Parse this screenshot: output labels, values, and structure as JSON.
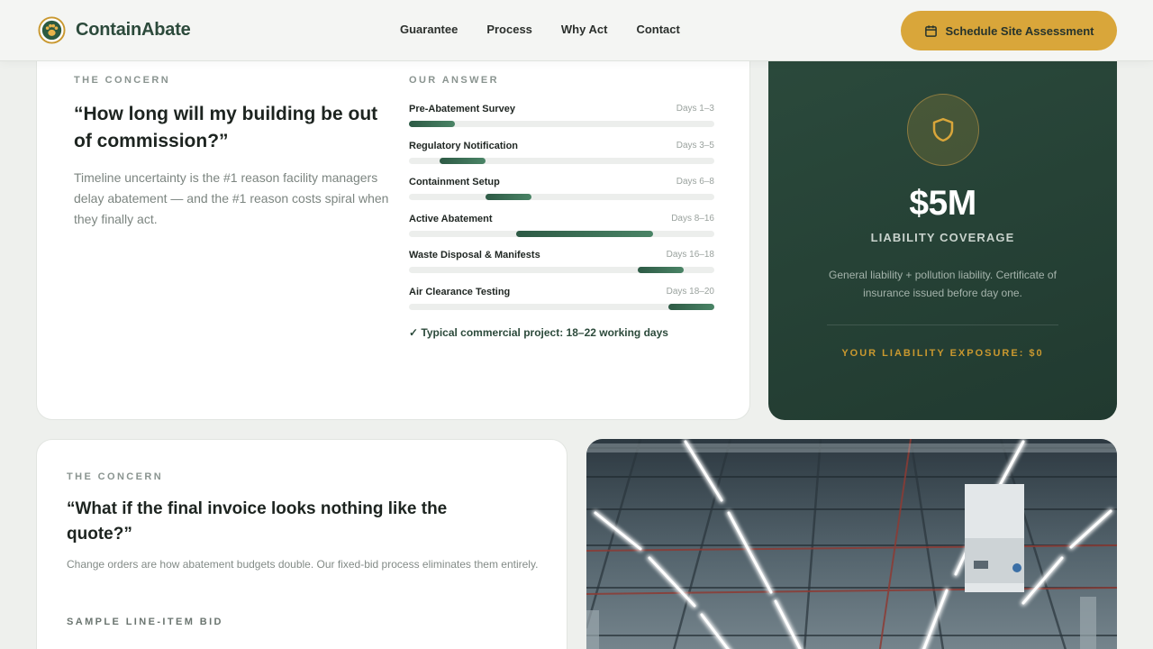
{
  "brand": {
    "name": "ContainAbate",
    "logo_icon": "paw-shield-icon"
  },
  "nav": {
    "items": [
      "Guarantee",
      "Process",
      "Why Act",
      "Contact"
    ]
  },
  "cta": {
    "label": "Schedule Site Assessment",
    "icon": "calendar-icon"
  },
  "concern1": {
    "eyebrow": "THE CONCERN",
    "quote": "“How long will my building be out of commission?”",
    "description": "Timeline uncertainty is the #1 reason facility managers delay abatement — and the #1 reason costs spiral when they finally act.",
    "answer_eyebrow": "OUR ANSWER",
    "timeline": [
      {
        "label": "Pre-Abatement Survey",
        "days": "Days 1–3",
        "start": 1,
        "end": 3
      },
      {
        "label": "Regulatory Notification",
        "days": "Days 3–5",
        "start": 3,
        "end": 5
      },
      {
        "label": "Containment Setup",
        "days": "Days 6–8",
        "start": 6,
        "end": 8
      },
      {
        "label": "Active Abatement",
        "days": "Days 8–16",
        "start": 8,
        "end": 16
      },
      {
        "label": "Waste Disposal & Manifests",
        "days": "Days 16–18",
        "start": 16,
        "end": 18
      },
      {
        "label": "Air Clearance Testing",
        "days": "Days 18–20",
        "start": 18,
        "end": 20
      }
    ],
    "summary": "✓ Typical commercial project: 18–22 working days"
  },
  "guarantee": {
    "icon": "shield-icon",
    "amount": "$5M",
    "title": "LIABILITY COVERAGE",
    "description": "General liability + pollution liability. Certificate of insurance issued before day one.",
    "exposure": "YOUR LIABILITY EXPOSURE: $0",
    "accent": "#d9a63a",
    "background": "#24402f"
  },
  "concern2": {
    "eyebrow": "THE CONCERN",
    "quote": "“What if the final invoice looks nothing like the quote?”",
    "description": "Change orders are how abatement budgets double. Our fixed-bid process eliminates them entirely.",
    "sub_eyebrow": "SAMPLE LINE-ITEM BID"
  },
  "photo": {
    "subject": "warehouse-ceiling-lights-photo"
  },
  "colors": {
    "accent": "#d9a63a",
    "brand_green": "#2c4a3b",
    "bar_green": "#2d5a45"
  }
}
